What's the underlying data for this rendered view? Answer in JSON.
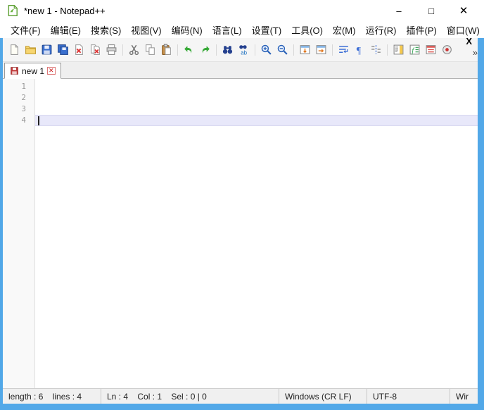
{
  "window": {
    "title": "*new 1 - Notepad++",
    "controls": {
      "minimize": "–",
      "maximize": "□",
      "close": "✕"
    }
  },
  "menubar": {
    "items": [
      {
        "label": "文件(F)"
      },
      {
        "label": "编辑(E)"
      },
      {
        "label": "搜索(S)"
      },
      {
        "label": "视图(V)"
      },
      {
        "label": "编码(N)"
      },
      {
        "label": "语言(L)"
      },
      {
        "label": "设置(T)"
      },
      {
        "label": "工具(O)"
      },
      {
        "label": "宏(M)"
      },
      {
        "label": "运行(R)"
      },
      {
        "label": "插件(P)"
      },
      {
        "label": "窗口(W)"
      },
      {
        "label": "?"
      }
    ],
    "close_x": "X"
  },
  "toolbar": {
    "overflow": "»",
    "icons": [
      "new-file",
      "open-folder",
      "save",
      "save-all",
      "close-document",
      "close-all-documents",
      "print",
      "cut",
      "copy",
      "paste",
      "undo",
      "redo",
      "find",
      "replace",
      "zoom-in",
      "zoom-out",
      "sync-vertical-scroll",
      "sync-horizontal-scroll",
      "word-wrap",
      "show-all-characters",
      "indent-guide",
      "document-map",
      "function-list",
      "file-browser",
      "macro-record"
    ]
  },
  "tabbar": {
    "tabs": [
      {
        "label": "new 1",
        "modified": true
      }
    ],
    "tab_close": "✕"
  },
  "editor": {
    "line_numbers": [
      "1",
      "2",
      "3",
      "4"
    ],
    "current_line": 4
  },
  "statusbar": {
    "doc_info": "length : 6    lines : 4",
    "cursor_info": "Ln : 4    Col : 1    Sel : 0 | 0",
    "eol_format": "Windows (CR LF)",
    "encoding": "UTF-8",
    "right_text": "Wir"
  },
  "colors": {
    "accent_border": "#52a8e8",
    "current_line": "#e8e8fa",
    "modified_indicator": "#c23b3b"
  }
}
